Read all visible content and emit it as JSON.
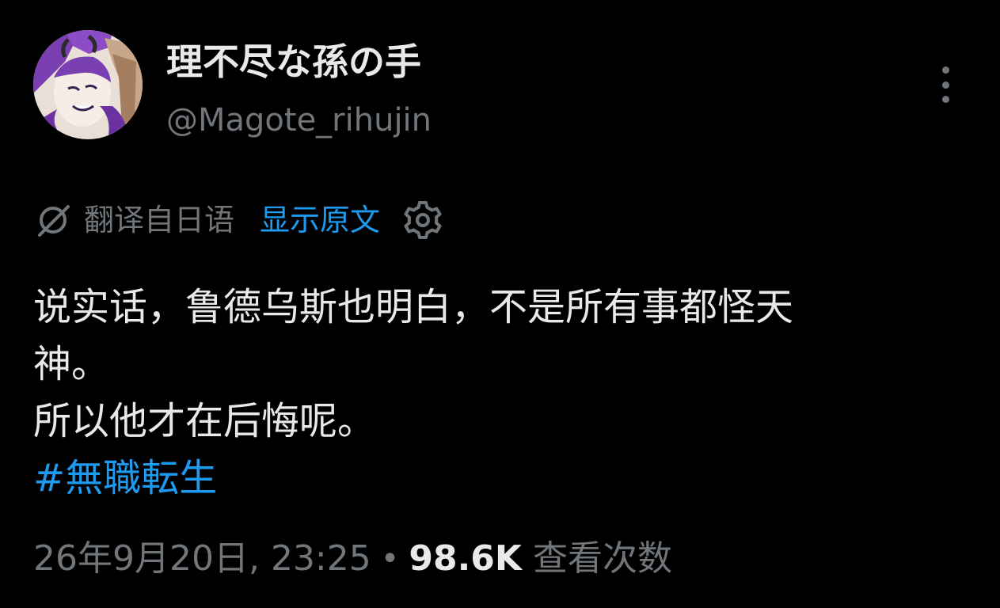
{
  "author": {
    "display_name": "理不尽な孫の手",
    "handle": "@Magote_rihujin",
    "avatar_icon": "avatar-anime-girl-purple-hair"
  },
  "translation_bar": {
    "icon": "translate-slash-icon",
    "label": "翻译自日语",
    "show_original": "显示原文",
    "settings_icon": "gear-icon"
  },
  "tweet": {
    "lines": [
      "说实话，鲁德乌斯也明白，不是所有事都怪天",
      "神。",
      "所以他才在后悔呢。"
    ],
    "hashtag": "#無職転生"
  },
  "meta": {
    "timestamp": "26年9月20日, 23:25",
    "separator": "•",
    "views_count": "98.6K",
    "views_label": "查看次数"
  },
  "colors": {
    "background": "#000000",
    "text": "#e7e9ea",
    "muted": "#71767b",
    "accent": "#1d9bf0"
  }
}
